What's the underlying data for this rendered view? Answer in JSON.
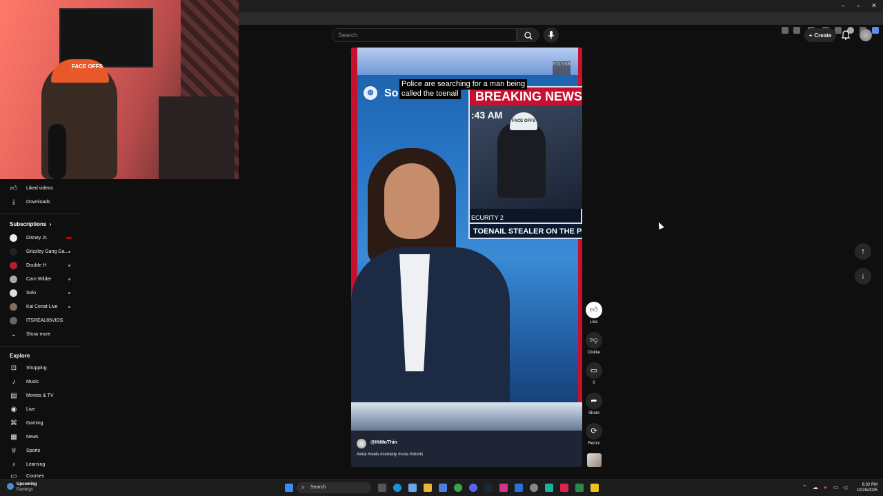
{
  "header": {
    "search_placeholder": "Search",
    "create_label": "Create"
  },
  "webcam": {
    "hat_text": "FACE OFFS"
  },
  "sidebar": {
    "library": [
      {
        "label": "Liked videos",
        "icon": "thumbs-up-icon"
      },
      {
        "label": "Downloads",
        "icon": "download-icon"
      }
    ],
    "subscriptions_title": "Subscriptions",
    "subscriptions": [
      {
        "label": "Disney Jr.",
        "badge": "live",
        "avatar_color": "#e7ecf5"
      },
      {
        "label": "Grizzley Gang Ga...",
        "badge": "dot",
        "avatar_color": "#222222"
      },
      {
        "label": "Double H",
        "badge": "dot",
        "avatar_color": "#b02030"
      },
      {
        "label": "Cam Wilder",
        "badge": "dot",
        "avatar_color": "#aaaaaa"
      },
      {
        "label": "Solo",
        "badge": "dot",
        "avatar_color": "#dddddd"
      },
      {
        "label": "Kai Cenat Live",
        "badge": "dot",
        "avatar_color": "#8a6a5a"
      },
      {
        "label": "ITSREAL85VIDS",
        "badge": "",
        "avatar_color": "#666666"
      }
    ],
    "show_more": "Show more",
    "explore_title": "Explore",
    "explore": [
      {
        "label": "Shopping",
        "icon": "shopping-bag-icon"
      },
      {
        "label": "Music",
        "icon": "music-note-icon"
      },
      {
        "label": "Movies & TV",
        "icon": "film-icon"
      },
      {
        "label": "Live",
        "icon": "live-icon"
      },
      {
        "label": "Gaming",
        "icon": "gamepad-icon"
      },
      {
        "label": "News",
        "icon": "news-icon"
      },
      {
        "label": "Sports",
        "icon": "trophy-icon"
      },
      {
        "label": "Learning",
        "icon": "lightbulb-icon"
      }
    ],
    "partial_item": "Courses"
  },
  "video": {
    "subtitle_line1": "Police are searching for a man being",
    "subtitle_line2": "called the toenail",
    "logo_text": "So",
    "badge": "RTX VSR",
    "breaking": "BREAKING NEWS",
    "time": ":43 AM",
    "security": "ECURITY 2",
    "lower_third": "TOENAIL STEALER ON THE PROW",
    "channel": "@HiMoThin",
    "tags": "#viral #reels #comedy #sora #shorts"
  },
  "actions": {
    "like": "Like",
    "dislike": "Dislike",
    "comments": "0",
    "share": "Share",
    "remix": "Remix"
  },
  "taskbar": {
    "weather_title": "Upcoming",
    "weather_sub": "Earnings",
    "search": "Search",
    "time": "8:32 PM",
    "date": "10/25/2025"
  }
}
